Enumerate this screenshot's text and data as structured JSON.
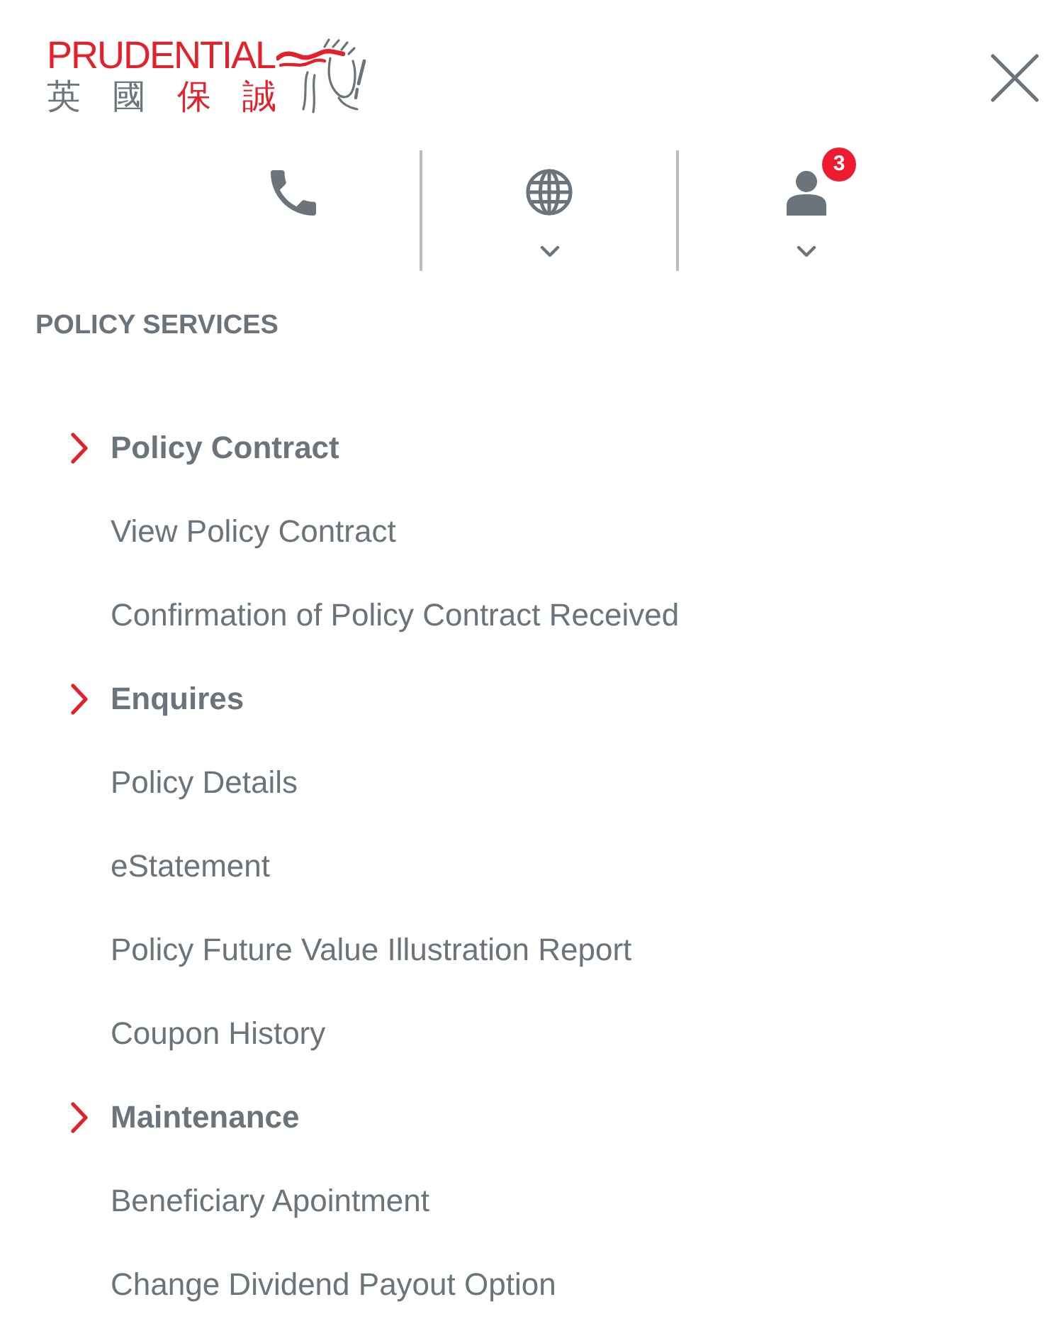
{
  "header": {
    "logo": {
      "wordmark": "PRUDENTIAL",
      "characters": [
        {
          "text": "英",
          "color": "#6d767c"
        },
        {
          "text": "國",
          "color": "#6d767c"
        },
        {
          "text": "保",
          "color": "#e4202b"
        },
        {
          "text": "誠",
          "color": "#e4202b"
        }
      ]
    }
  },
  "utility_bar": {
    "items": [
      {
        "kind": "phone",
        "dropdown": false
      },
      {
        "kind": "language",
        "dropdown": true
      },
      {
        "kind": "account",
        "dropdown": true,
        "badge": "3"
      }
    ]
  },
  "section_title": "POLICY SERVICES",
  "menu": [
    {
      "label": "Policy Contract",
      "children": [
        {
          "label": "View Policy Contract"
        },
        {
          "label": "Confirmation of Policy Contract Received"
        }
      ]
    },
    {
      "label": "Enquires",
      "children": [
        {
          "label": "Policy Details"
        },
        {
          "label": "eStatement"
        },
        {
          "label": "Policy Future Value Illustration Report"
        },
        {
          "label": "Coupon History"
        }
      ]
    },
    {
      "label": "Maintenance",
      "children": [
        {
          "label": "Beneficiary Apointment"
        },
        {
          "label": "Change Dividend Payout Option"
        }
      ]
    }
  ]
}
